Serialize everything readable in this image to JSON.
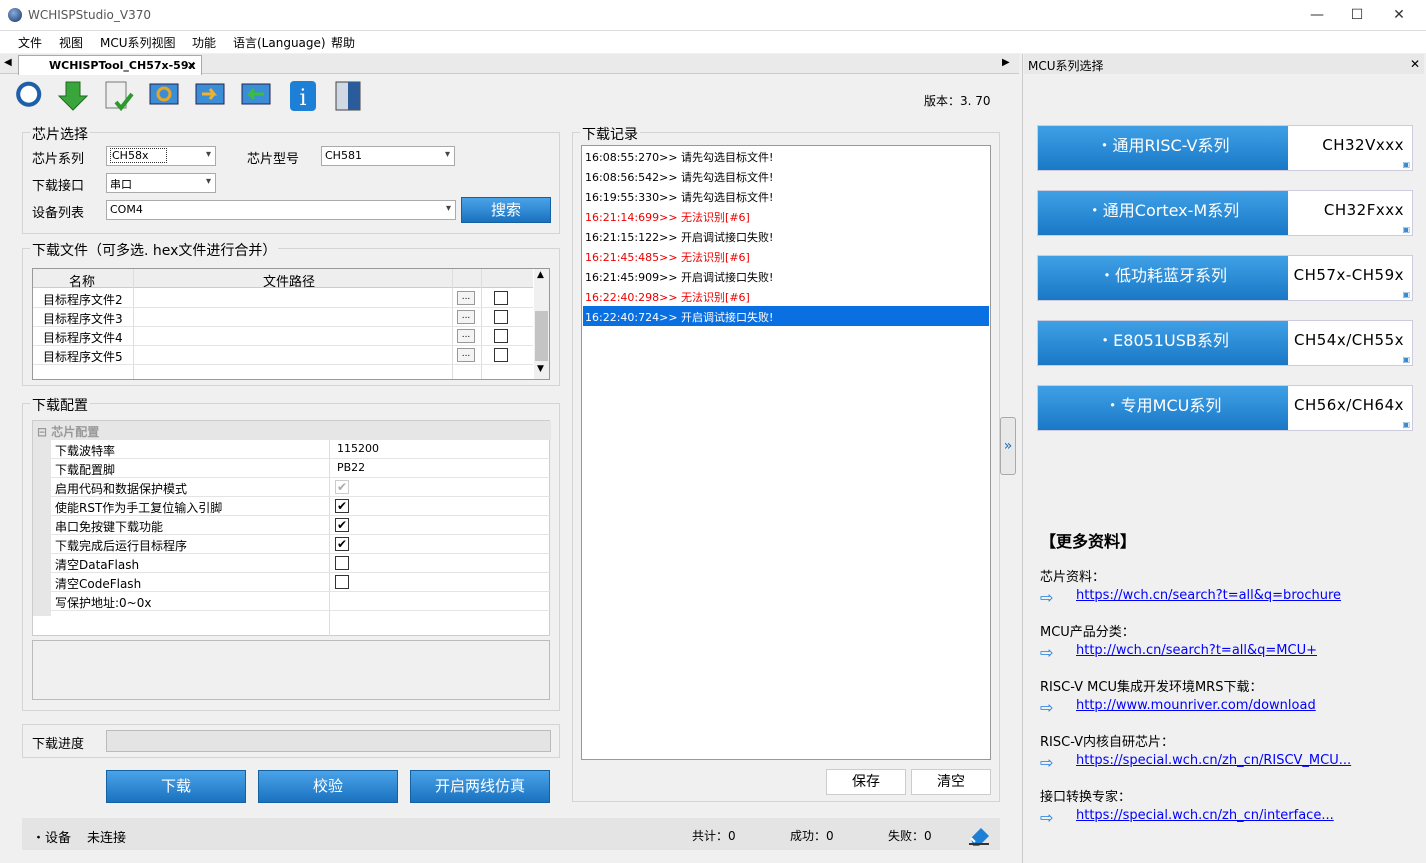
{
  "window": {
    "title": "WCHISPStudio_V370",
    "min": "—",
    "max": "☐",
    "close": "✕"
  },
  "menu": [
    "文件",
    "视图",
    "MCU系列视图",
    "功能",
    "语言(Language)",
    "帮助"
  ],
  "tab": {
    "label": "WCHISPTool_CH57x-59x",
    "close": "✕"
  },
  "version": "版本：3. 70",
  "toolbar_icons": [
    "search-chip-icon",
    "download-icon",
    "verify-icon",
    "refresh-icon",
    "export-icon",
    "import-icon",
    "info-icon",
    "book-icon"
  ],
  "chip": {
    "group": "芯片选择",
    "series_label": "芯片系列",
    "series": "CH58x",
    "model_label": "芯片型号",
    "model": "CH581",
    "iface_label": "下载接口",
    "iface": "串口",
    "device_label": "设备列表",
    "device": "COM4",
    "search": "搜索"
  },
  "files": {
    "group": "下载文件（可多选. hex文件进行合并）",
    "col_name": "名称",
    "col_path": "文件路径",
    "rows": [
      "目标程序文件2",
      "目标程序文件3",
      "目标程序文件4",
      "目标程序文件5"
    ],
    "browse": "..."
  },
  "config": {
    "group": "下载配置",
    "section": "芯片配置",
    "rows": [
      {
        "label": "下载波特率",
        "value": "115200",
        "check": null
      },
      {
        "label": "下载配置脚",
        "value": "PB22",
        "check": null
      },
      {
        "label": "启用代码和数据保护模式",
        "value": "",
        "check": "gray"
      },
      {
        "label": "使能RST作为手工复位输入引脚",
        "value": "",
        "check": "on"
      },
      {
        "label": "串口免按键下载功能",
        "value": "",
        "check": "on"
      },
      {
        "label": "下载完成后运行目标程序",
        "value": "",
        "check": "on"
      },
      {
        "label": "清空DataFlash",
        "value": "",
        "check": "off"
      },
      {
        "label": "清空CodeFlash",
        "value": "",
        "check": "off"
      },
      {
        "label": "写保护地址:0~0x",
        "value": "",
        "check": null
      }
    ]
  },
  "progress": {
    "label": "下载进度",
    "percent": 0
  },
  "buttons": {
    "download": "下载",
    "verify": "校验",
    "twowire": "开启两线仿真",
    "save": "保存",
    "clear": "清空"
  },
  "log": {
    "group": "下载记录",
    "entries": [
      {
        "t": "16:08:55:270>> 请先勾选目标文件!",
        "type": "normal"
      },
      {
        "t": "16:08:56:542>> 请先勾选目标文件!",
        "type": "normal"
      },
      {
        "t": "16:19:55:330>> 请先勾选目标文件!",
        "type": "normal"
      },
      {
        "t": "16:21:14:699>> 无法识别[#6]",
        "type": "error"
      },
      {
        "t": "16:21:15:122>> 开启调试接口失败!",
        "type": "normal"
      },
      {
        "t": "16:21:45:485>> 无法识别[#6]",
        "type": "error"
      },
      {
        "t": "16:21:45:909>> 开启调试接口失败!",
        "type": "normal"
      },
      {
        "t": "16:22:40:298>> 无法识别[#6]",
        "type": "error"
      },
      {
        "t": "16:22:40:724>> 开启调试接口失败!",
        "type": "selected"
      }
    ]
  },
  "status": {
    "device": "・设备",
    "state": "未连接",
    "total": "共计：0",
    "success": "成功：0",
    "fail": "失败：0"
  },
  "right": {
    "title": "MCU系列选择",
    "close": "✕",
    "expand": "»",
    "series": [
      {
        "name": "・通用RISC-V系列",
        "chip": "CH32Vxxx"
      },
      {
        "name": "・通用Cortex-M系列",
        "chip": "CH32Fxxx"
      },
      {
        "name": "・低功耗蓝牙系列",
        "chip": "CH57x-CH59x"
      },
      {
        "name": "・E8051USB系列",
        "chip": "CH54x/CH55x"
      },
      {
        "name": "・专用MCU系列",
        "chip": "CH56x/CH64x"
      }
    ],
    "more": "【更多资料】",
    "links": [
      {
        "label": "芯片资料：",
        "url": "https://wch.cn/search?t=all&q=brochure"
      },
      {
        "label": "MCU产品分类：",
        "url": "http://wch.cn/search?t=all&q=MCU+"
      },
      {
        "label": "RISC-V MCU集成开发环境MRS下载：",
        "url": "http://www.mounriver.com/download"
      },
      {
        "label": "RISC-V内核自研芯片：",
        "url": "https://special.wch.cn/zh_cn/RISCV_MCU..."
      },
      {
        "label": "接口转换专家：",
        "url": "https://special.wch.cn/zh_cn/interface..."
      }
    ]
  }
}
